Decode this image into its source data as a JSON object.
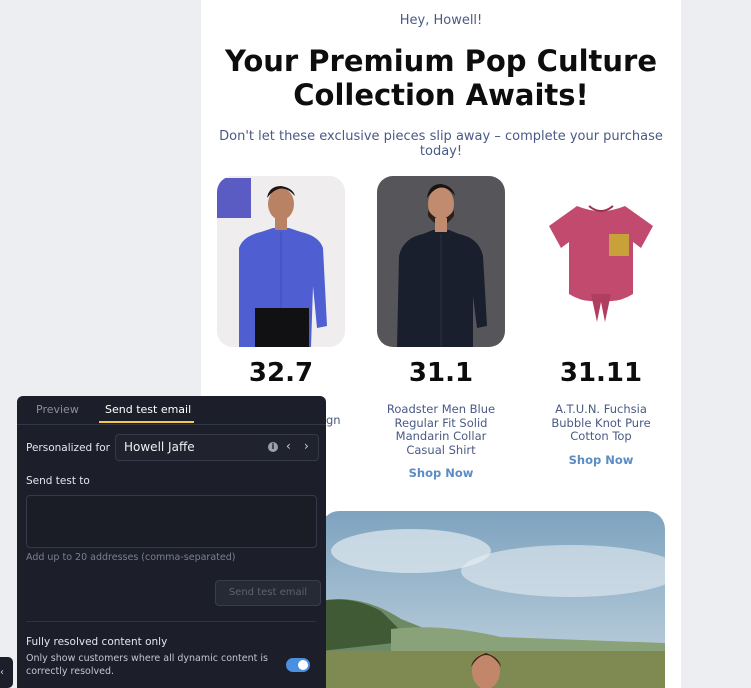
{
  "email": {
    "greeting": "Hey, Howell!",
    "headline_line1": "Your Premium Pop Culture",
    "headline_line2": "Collection Awaits!",
    "subheadline": "Don't let these exclusive pieces slip away – complete your purchase today!",
    "products": [
      {
        "price": "32.7",
        "name_visible": "gn",
        "cta": ""
      },
      {
        "price": "31.1",
        "name": "Roadster Men Blue Regular Fit Solid Mandarin Collar Casual Shirt",
        "cta": "Shop Now"
      },
      {
        "price": "31.11",
        "name": "A.T.U.N. Fuchsia Bubble Knot Pure Cotton Top",
        "cta": "Shop Now"
      }
    ]
  },
  "panel": {
    "tabs": {
      "preview": "Preview",
      "send_test": "Send test email"
    },
    "personalized_label": "Personalized for",
    "personalized_value": "Howell Jaffe",
    "send_to_label": "Send test to",
    "send_to_value": "",
    "hint": "Add up to 20 addresses (comma-separated)",
    "send_button": "Send test email",
    "fully_resolved_title": "Fully resolved content only",
    "fully_resolved_desc": "Only show customers where all dynamic content is correctly resolved.",
    "toggle_on": true
  },
  "icons": {
    "info": "info-icon",
    "prev": "chevron-left-icon",
    "next": "chevron-right-icon",
    "collapse": "chevron-left-icon"
  },
  "colors": {
    "panel_bg": "#1c1f29",
    "tab_active_underline": "#f2c94c",
    "toggle_on": "#4a8fe0",
    "link": "#5b8cc4",
    "body_text": "#4a5a86"
  }
}
